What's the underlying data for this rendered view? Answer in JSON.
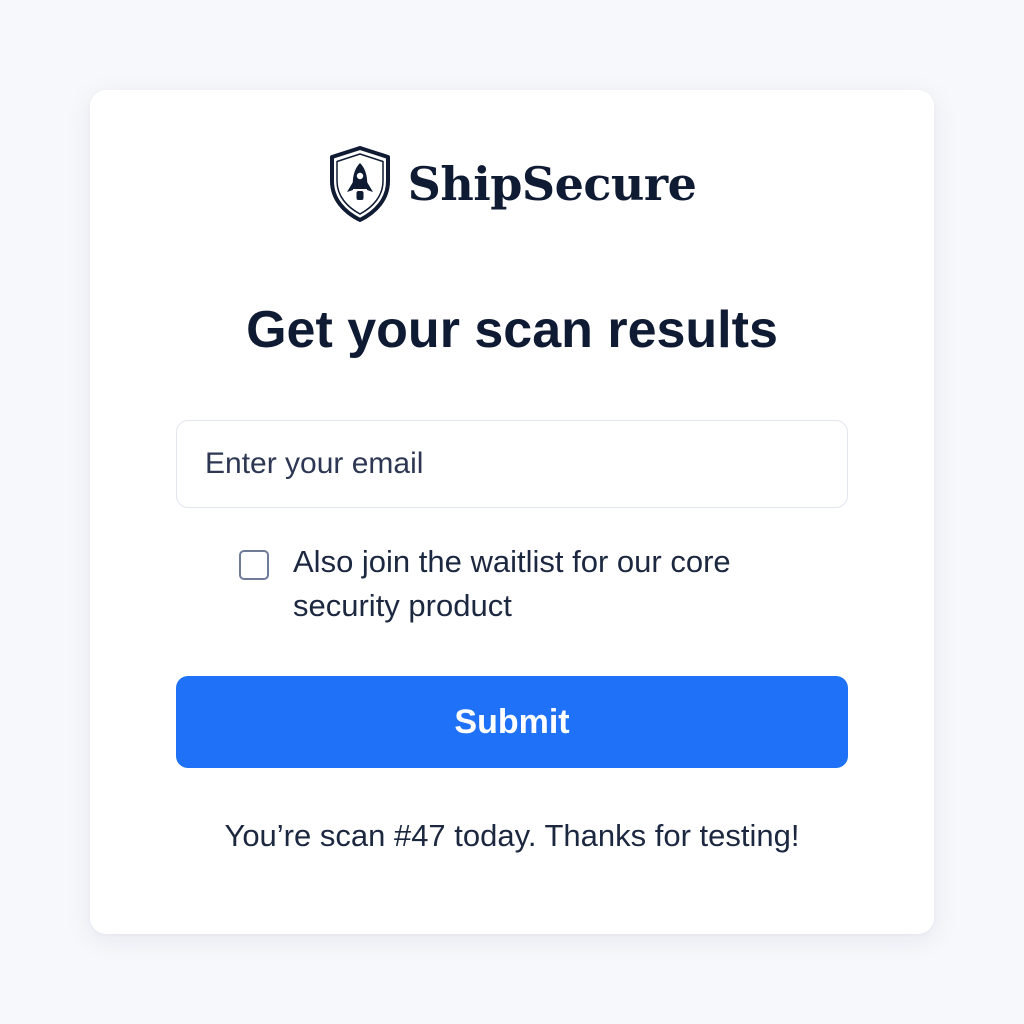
{
  "brand": {
    "name": "ShipSecure",
    "logo_icon": "shield-rocket-icon",
    "color": "#0f1a33"
  },
  "form": {
    "title": "Get your scan results",
    "email": {
      "placeholder": "Enter your email",
      "value": ""
    },
    "waitlist": {
      "label": "Also join the waitlist for our core security product",
      "checked": false
    },
    "submit_label": "Submit"
  },
  "footer": {
    "message": "You’re scan #47 today. Thanks for testing!"
  },
  "colors": {
    "background": "#f7f8fc",
    "card": "#ffffff",
    "accent": "#1f72f8",
    "text": "#0f1a33"
  }
}
